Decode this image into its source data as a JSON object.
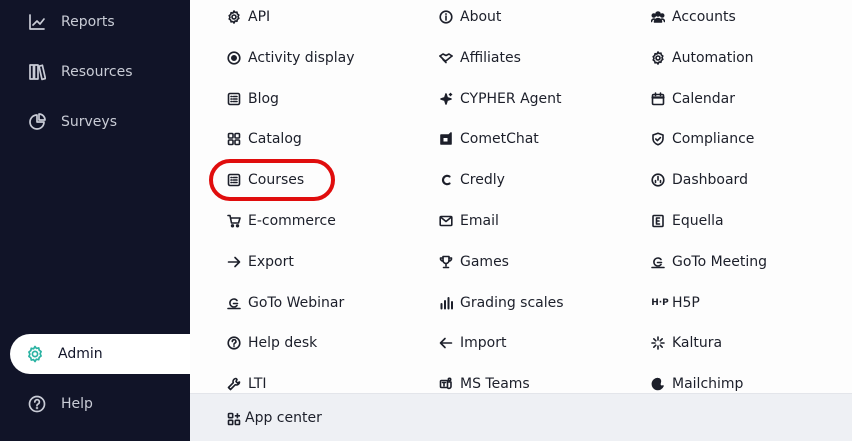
{
  "sidebar": {
    "items": [
      {
        "label": "Reports",
        "icon": "chart-line-icon"
      },
      {
        "label": "Resources",
        "icon": "books-icon"
      },
      {
        "label": "Surveys",
        "icon": "pie-chart-icon"
      },
      {
        "label": "Admin",
        "icon": "gear-icon",
        "active": true
      },
      {
        "label": "Help",
        "icon": "help-circle-icon"
      }
    ],
    "accent": "#2bb3a3",
    "background": "#111428"
  },
  "menu": {
    "col1": [
      {
        "label": "API",
        "icon": "api-gear-icon"
      },
      {
        "label": "Activity display",
        "icon": "target-icon"
      },
      {
        "label": "Blog",
        "icon": "list-doc-icon"
      },
      {
        "label": "Catalog",
        "icon": "grid-icon"
      },
      {
        "label": "Courses",
        "icon": "list-doc-icon"
      },
      {
        "label": "E-commerce",
        "icon": "cart-icon"
      },
      {
        "label": "Export",
        "icon": "arrow-right-icon"
      },
      {
        "label": "GoTo Webinar",
        "icon": "goto-icon"
      },
      {
        "label": "Help desk",
        "icon": "question-circle-icon"
      },
      {
        "label": "LTI",
        "icon": "wrench-icon"
      }
    ],
    "col2": [
      {
        "label": "About",
        "icon": "info-circle-icon"
      },
      {
        "label": "Affiliates",
        "icon": "handshake-icon"
      },
      {
        "label": "CYPHER Agent",
        "icon": "sparkle-icon"
      },
      {
        "label": "CometChat",
        "icon": "cometchat-icon"
      },
      {
        "label": "Credly",
        "icon": "credly-icon"
      },
      {
        "label": "Email",
        "icon": "envelope-icon"
      },
      {
        "label": "Games",
        "icon": "trophy-icon"
      },
      {
        "label": "Grading scales",
        "icon": "bar-chart-icon"
      },
      {
        "label": "Import",
        "icon": "arrow-left-icon"
      },
      {
        "label": "MS Teams",
        "icon": "teams-icon"
      }
    ],
    "col3": [
      {
        "label": "Accounts",
        "icon": "users-icon"
      },
      {
        "label": "Automation",
        "icon": "gear-outline-icon"
      },
      {
        "label": "Calendar",
        "icon": "calendar-icon"
      },
      {
        "label": "Compliance",
        "icon": "shield-check-icon"
      },
      {
        "label": "Dashboard",
        "icon": "dashboard-icon"
      },
      {
        "label": "Equella",
        "icon": "equella-icon"
      },
      {
        "label": "GoTo Meeting",
        "icon": "goto-icon"
      },
      {
        "label": "H5P",
        "icon": "h5p-icon"
      },
      {
        "label": "Kaltura",
        "icon": "kaltura-icon"
      },
      {
        "label": "Mailchimp",
        "icon": "mailchimp-icon"
      }
    ]
  },
  "footer": {
    "label": "App center",
    "icon": "app-grid-icon"
  },
  "highlight_color": "#e00d0d"
}
